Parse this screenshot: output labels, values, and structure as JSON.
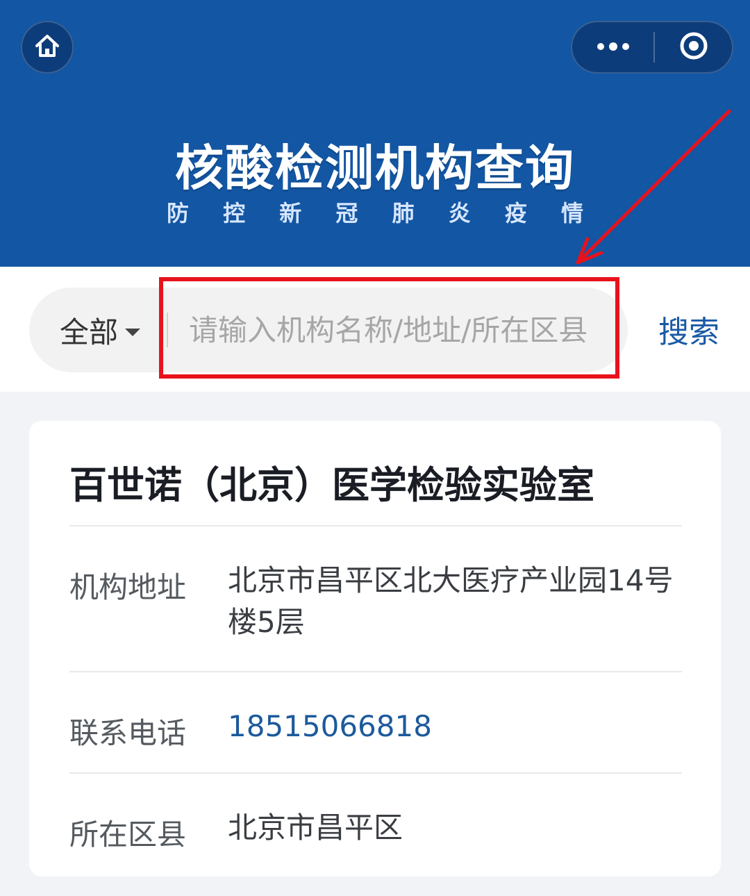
{
  "header": {
    "title": "核酸检测机构查询",
    "subtitle_chars": [
      "防",
      "控",
      "新",
      "冠",
      "肺",
      "炎",
      "疫",
      "情"
    ]
  },
  "nav": {
    "home_icon": "home-icon",
    "more_icon": "more-dots-icon",
    "close_icon": "circle-target-icon"
  },
  "search": {
    "region_label": "全部",
    "placeholder": "请输入机构名称/地址/所在区县",
    "value": "",
    "button_label": "搜索"
  },
  "result": {
    "name": "百世诺（北京）医学检验实验室",
    "rows": [
      {
        "label": "机构地址",
        "value": "北京市昌平区北大医疗产业园14号楼5层"
      },
      {
        "label": "联系电话",
        "value": "18515066818"
      },
      {
        "label": "所在区县",
        "value": "北京市昌平区"
      }
    ]
  },
  "colors": {
    "header_bg": "#1356a3",
    "accent": "#1a5aa6",
    "annotation": "#e8121b"
  }
}
